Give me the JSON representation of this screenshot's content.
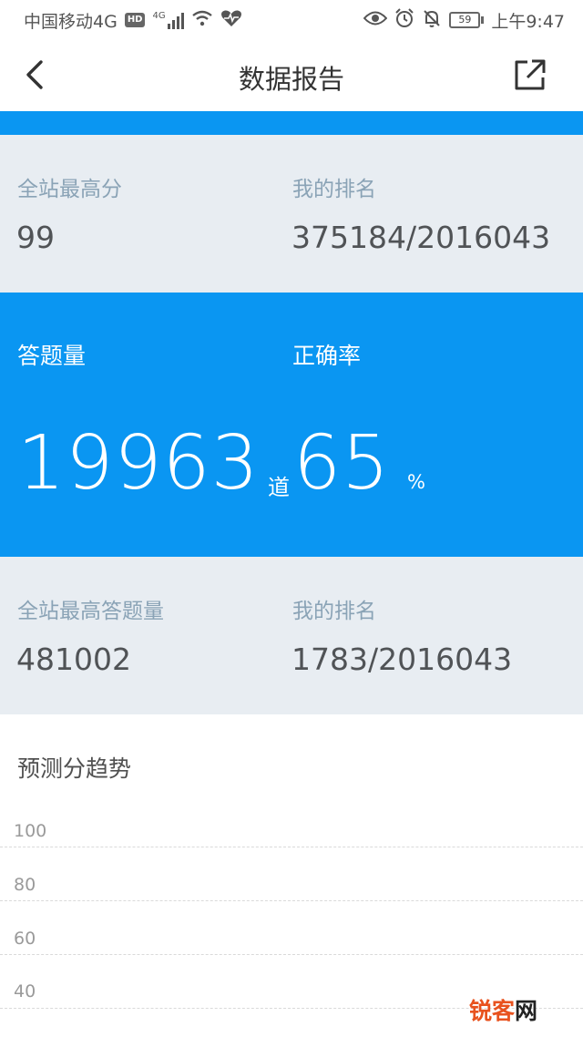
{
  "status_bar": {
    "carrier": "中国移动4G",
    "hd_badge": "HD",
    "signal_label": "4G",
    "battery_level": "59",
    "time": "上午9:47"
  },
  "header": {
    "title": "数据报告"
  },
  "top_stats": {
    "site_high_score_label": "全站最高分",
    "site_high_score_value": "99",
    "my_rank_label": "我的排名",
    "my_rank_value": "375184/2016043"
  },
  "main_stats": {
    "answered_label": "答题量",
    "answered_value": "19963",
    "answered_unit": "道",
    "accuracy_label": "正确率",
    "accuracy_value": "65",
    "accuracy_unit": "%"
  },
  "bottom_stats": {
    "site_max_answered_label": "全站最高答题量",
    "site_max_answered_value": "481002",
    "my_rank_label": "我的排名",
    "my_rank_value": "1783/2016043"
  },
  "trend": {
    "title": "预测分趋势",
    "y_ticks": [
      "100",
      "80",
      "60",
      "40"
    ]
  },
  "watermark": {
    "part1": "锐客",
    "part2": "网"
  },
  "colors": {
    "accent": "#0a96f2",
    "panel_bg": "#e8edf2",
    "label_muted": "#8aa3b6"
  }
}
